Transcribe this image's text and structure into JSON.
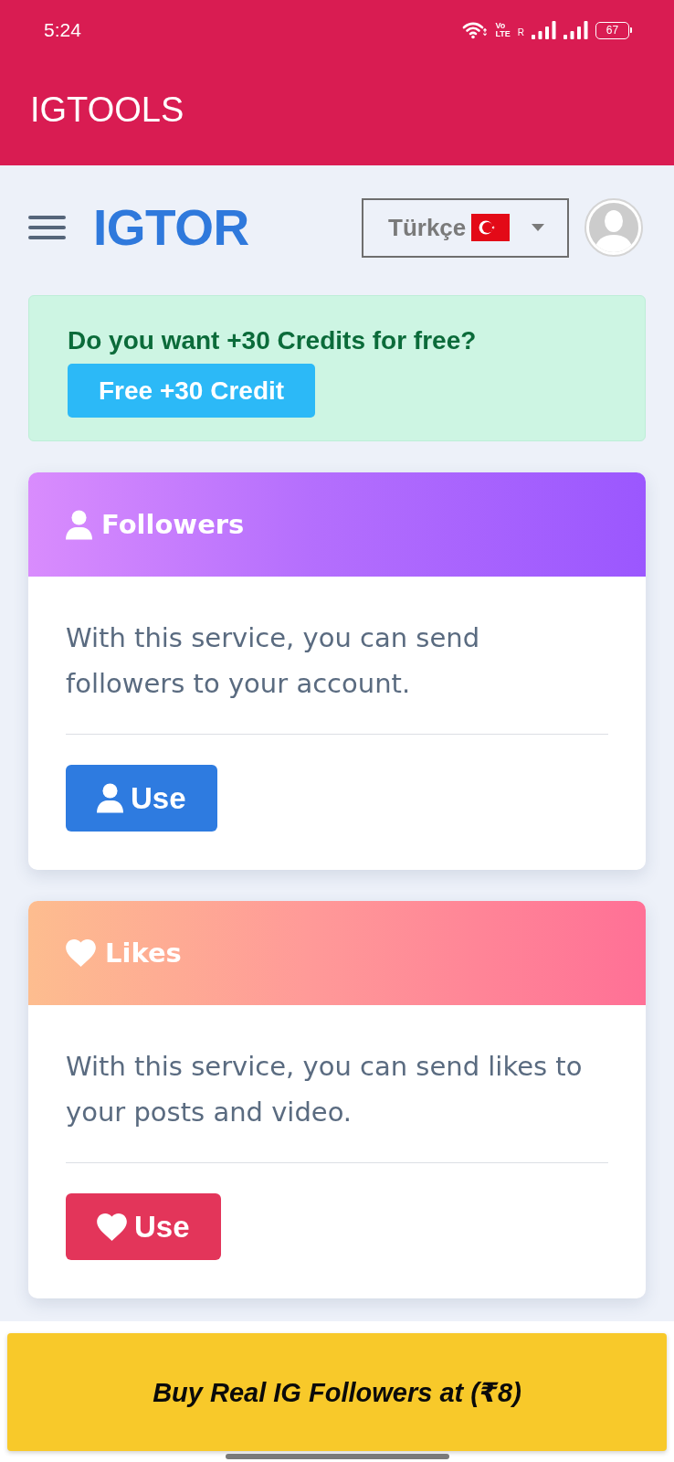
{
  "status_bar": {
    "time": "5:24",
    "network": [
      "Vo",
      "LTE"
    ],
    "roaming": "R",
    "battery": "67"
  },
  "app_bar": {
    "title": "IGTOOLS"
  },
  "header": {
    "logo": "IGTOR",
    "language": "Türkçe"
  },
  "promo": {
    "title": "Do you want +30 Credits for free?",
    "button": "Free +30 Credit"
  },
  "services": [
    {
      "kind": "followers",
      "title": "Followers",
      "description": "With this service, you can send followers to your account.",
      "button": "Use"
    },
    {
      "kind": "likes",
      "title": "Likes",
      "description": "With this service, you can send likes to your posts and video.",
      "button": "Use"
    }
  ],
  "banner": {
    "label": "Buy Real IG Followers at (₹8)"
  }
}
